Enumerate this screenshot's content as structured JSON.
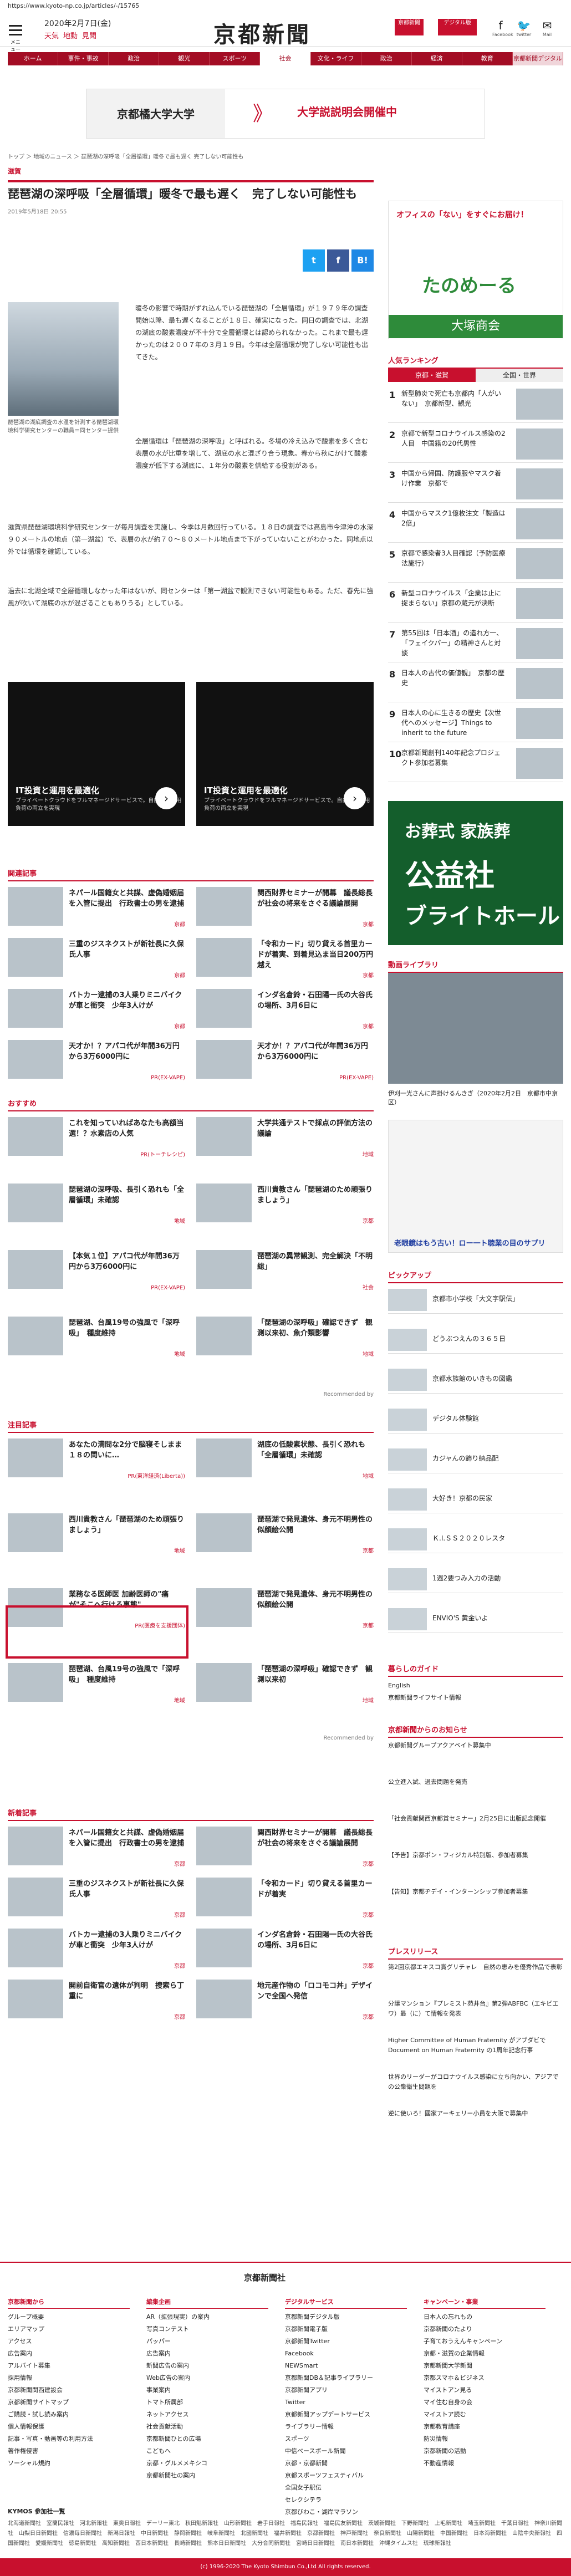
{
  "url": "https://www.kyoto-np.co.jp/articles/-/15765",
  "header": {
    "date": "2020年2月7日(金)",
    "wx": [
      "天気",
      "地動",
      "見聞"
    ],
    "logo": "京都新聞",
    "btn1": "京都新聞",
    "btn2": "デジタル版",
    "sns": [
      "Facebook",
      "twitter",
      "Mail"
    ],
    "menu": "メニュー"
  },
  "nav": [
    "ホーム",
    "事件・事故",
    "政治",
    "観光",
    "スポーツ",
    "社会",
    "文化・ライフ",
    "政治",
    "経済",
    "教育",
    "京都新聞デジタル"
  ],
  "banner": {
    "t1": "京都橘大学大学",
    "t2": "大学説説明会開催中"
  },
  "breadcrumb": "トップ ＞ 地域のニュース ＞ 琵琶湖の深呼吸「全層循環」暖冬で最も遅く 完了しない可能性も",
  "article": {
    "cat": "滋賀",
    "title": "琵琶湖の深呼吸「全層循環」暖冬で最も遅く　完了しない可能性も",
    "date": "2019年5月18日 20:55",
    "cap": "琵琶湖の湖底調査の水温を計測する琵琶湖環境科学研究センターの職員＝同センター提供",
    "p1": "暖冬の影響で時期がずれ込んでいる琵琶湖の「全層循環」が１９７９年の調査開始以降、最も遅くなることが１８日、確実になった。同日の調査では、北湖の湖底の酸素濃度が不十分で全層循環とは認められなかった。これまで最も遅かったのは２００７年の３月１９日。今年は全層循環が完了しない可能性も出てきた。",
    "p2": "全層循環は「琵琶湖の深呼吸」と呼ばれる。冬場の冷え込みで酸素を多く含む表層の水が比重を増して、湖底の水と混ざり合う現象。春から秋にかけて酸素濃度が低下する湖底に、１年分の酸素を供給する役割がある。",
    "p3": "滋賀県琵琶湖環境科学研究センターが毎月調査を実施し、今季は月数回行っている。１８日の調査では高島市今津沖の水深９０メートルの地点（第一湖盆）で、表層の水が約７０〜８０メートル地点まで下がっていないことがわかった。同地点以外では循環を確認している。",
    "p4": "過去に北湖全域で全層循環しなかった年はないが、同センターは「第一湖盆で観測できない可能性もある。ただ、春先に強風が吹いて湖底の水が混ざることもありうる」としている。"
  },
  "promo": [
    {
      "t": "IT投資と運用を最適化",
      "s": "プライベートクラウドをフルマネージドサービスで。自由度と運用負荷の両立を実現",
      "c": "日立製作所"
    },
    {
      "t": "IT投資と運用を最適化",
      "s": "プライベートクラウドをフルマネージドサービスで。自由度と運用負荷の両立を実現",
      "c": "日立製作所"
    }
  ],
  "sections": {
    "rel": "関連記事",
    "osusume": "おすすめ",
    "chumoku": "注目記事",
    "shinchaku": "新着記事"
  },
  "rel": [
    {
      "t": "ネパール国籍女と共謀、虚偽婚姻届を入管に提出　行政書士の男を逮捕",
      "g": "京都"
    },
    {
      "t": "関西財界セミナーが開幕　議長総長が社会の将来をさぐる議論展開",
      "g": "京都"
    },
    {
      "t": "三重のジスネクストが新社長に久保氏人事",
      "g": "京都"
    },
    {
      "t": "「令和カード」切り貸える首里カードが着実、到着見込ま当日200万円越え",
      "g": "京都"
    },
    {
      "t": "バトカー逮捕の3人乗りミニバイクが車と衝突　少年3人けが",
      "g": "京都"
    },
    {
      "t": "インダ名倉鈴・石田陽一氏の大谷氏の場所、3月6日に",
      "g": "京都"
    },
    {
      "t": "天才か！？アパコ代が年間36万円から3万6000円に",
      "g": "PR(EX-VAPE)"
    },
    {
      "t": "天才か！？アパコ代が年間36万円から3万6000円に",
      "g": "PR(EX-VAPE)"
    }
  ],
  "osu": [
    {
      "t": "これを知っていればあなたも高額当選！？水素店の人気",
      "g": "PR(トーチレシピ)"
    },
    {
      "t": "大学共通テストで採点の評価方法の議論",
      "g": "地域"
    },
    {
      "t": "琵琶湖の深呼吸、長引く恐れも「全層循環」未確認",
      "g": "地域"
    },
    {
      "t": "西川貴教さん「琵琶湖のため頑張りましょう」",
      "g": "京都"
    },
    {
      "t": "【本気１位】アパコ代が年間36万円から3万6000円に",
      "g": "PR(EX-VAPE)"
    },
    {
      "t": "琵琶湖の異常観測、完全解決「不明総」",
      "g": "社会"
    },
    {
      "t": "琵琶湖、台風19号の強風で「深呼吸」　種度維持",
      "g": "地域"
    },
    {
      "t": "「琵琶湖の深呼吸」確認できず　観測以来初、魚介類影響",
      "g": "地域"
    }
  ],
  "chu": [
    {
      "t": "あなたの満問な2分で脳寝そしまま１８の問いに…",
      "g": "PR(東洋経済(Liberta))"
    },
    {
      "t": "湖底の低酸素状態、長引く恐れも「全層循環」未確認",
      "g": "地域"
    },
    {
      "t": "西川貴教さん「琵琶湖のため頑張りましょう」",
      "g": "地域"
    },
    {
      "t": "琵琶湖で発見遺体、身元不明男性の似顔絵公開",
      "g": "京都"
    },
    {
      "t": "業務なる医師医 加齢医師の\"痛が\"そこへ行ける事態\"",
      "g": "PR(医療を支援団体)"
    },
    {
      "t": "琵琶湖で発見遺体、身元不明男性の似顔絵公開",
      "g": "京都"
    },
    {
      "t": "琵琶湖、台風19号の強風で「深呼吸」　種度維持",
      "g": "地域"
    },
    {
      "t": "「琵琶湖の深呼吸」確認できず　観測以来初",
      "g": "地域"
    }
  ],
  "shin": [
    {
      "t": "ネパール国籍女と共謀、虚偽婚姻届を入管に提出　行政書士の男を逮捕",
      "g": "京都"
    },
    {
      "t": "関西財界セミナーが開幕　議長総長が社会の将来をさぐる議論展開",
      "g": "京都"
    },
    {
      "t": "三重のジスネクストが新社長に久保氏人事",
      "g": "京都"
    },
    {
      "t": "「令和カード」切り貸える首里カードが着実",
      "g": "京都"
    },
    {
      "t": "バトカー逮捕の3人乗りミニバイクが車と衝突　少年3人けが",
      "g": "京都"
    },
    {
      "t": "インダ名倉鈴・石田陽一氏の大谷氏の場所、3月6日に",
      "g": "京都"
    },
    {
      "t": "開前自衛官の遺体が判明　捜索ら丁重に",
      "g": "京都"
    },
    {
      "t": "地元産作物の「ロコモコ丼」デザインで全国へ発信",
      "g": "京都"
    }
  ],
  "uzou": "Recommended by",
  "side": {
    "ad1": "オフィスの「ない」をすぐにお届け！",
    "ad1b": "たのめーる",
    "ad1c": "大塚商会",
    "ranking": "人気ランキング",
    "rtabs": [
      "京都・滋賀",
      "全国・世界"
    ],
    "ranks": [
      "新型肺炎で死亡も京都内「人がいない」　京都新型、観光",
      "京都で新型コロナウイルス感染の2人目　中国籍の20代男性",
      "中国から帰国、防護服やマスク着け作業　京都で",
      "中国からマスク1億枚注文「製造は2倍」",
      "京都で感染者3人目確認（予防医療法施行）",
      "新型コロナウイルス「企業は止に捉まらない」京都の蔵元が決断",
      "第55回は「日本酒」の造れ方一、「フェイクパー」の精神さんと対談",
      "日本人の古代の価値観」　京都の歴史",
      "日本人の心に生きるの歴史【次世代へのメッセージ】Things to inherit to the future",
      "京都新聞創刊140年記念プロジェクト参加者募集"
    ],
    "ad2": "お葬式 家族葬",
    "ad2b": "公益社",
    "ad2c": "ブライトホール",
    "video": "動画ライブラリ",
    "vcap": "伊刈一光さんに声掛けるんきぎ（2020年2月2日　京都市中京区）",
    "ad3": "老眼鏡はもう古い！ロー一ト聴業の目のサプリ",
    "pickup": "ピックアップ",
    "picks": [
      "京都市小学校「大文字駅伝」",
      "どうぶつえんの３６５日",
      "京都水族館のいきもの図鑑",
      "デジタル体験館",
      "カジャんの飾り納品配",
      "大好き！京都の民家",
      "Ｋ.I.ＳＳ２０２０レスタ",
      "1週2要つみ入力の活動",
      "ENVIO'S 黄金いよ"
    ],
    "kurashi": "暮らしのガイド",
    "klinks": [
      "English",
      "京都新聞ライフサイト情報"
    ],
    "oshirase": "京都新聞からのお知らせ",
    "olinks": [
      "京都新聞グループアクアベイト募集中",
      "公立進入試、過去問題を発売",
      "「社会貢献関西京都賞セミナー」2月25日に出版記念開催",
      "【予告】京都ポン・フィジカル特別版、参加者募集",
      "【告知】京都ヂデイ・インターンシップ参加者募集"
    ],
    "press": "プレスリリース",
    "plinks": [
      "第2回京都エキスコ賞グリチャレ　自然の恵みを優秀作品で表彰",
      "分譲マンション『プレミスト苑井台』第2弾ABFBC（エキビエワ）最（に）て情報を発表",
      "Higher Committee of Human Fraternity がアブダビでDocument on Human Fraternity の1周年記念行事",
      "世界のリーダーがコロナウイルス感染に立ち向かい、アジアでの公衆衛生問題を",
      "逆に使いろ！國家アーキェリー小員を大阪で募集中"
    ]
  },
  "footer": {
    "logo": "京都新聞社",
    "cols": [
      {
        "h": "京都新聞から",
        "i": [
          "グループ概要",
          "エリアマップ",
          "アクセス",
          "広告案内",
          "アルバイト募集",
          "採用情報",
          "京都新聞関西建設会",
          "京都新聞サイトマップ",
          "ご購読・試し読み案内",
          "個人情報保護",
          "記事・写真・動画等の利用方法",
          "著作権侵害",
          "ソーシャル規約"
        ]
      },
      {
        "h": "編集企画",
        "i": [
          "AR（拡張現実）の案内",
          "写真コンテスト",
          "パッパー",
          "広告案内",
          "新聞広告の案内",
          "Web広告の案内",
          "事業案内",
          "トマト所属部",
          "ネットアクセス",
          "社会貢献活動",
          "京都新聞ひとの広場",
          "こどもへ",
          "京都・グルメメキシコ",
          "京都新聞社の案内"
        ]
      },
      {
        "h": "デジタルサービス",
        "i": [
          "京都新聞デジタル版",
          "京都新聞電子版",
          "京都新聞Twitter",
          "Facebook",
          "NEWSmart",
          "京都新聞DB＆記事ライブラリー",
          "京都新聞アプリ",
          "Twitter",
          "京都新聞アップデートサービス",
          "ライブラリー情報",
          "スポーツ",
          "中信ベースボール新聞",
          "京都・京都新聞",
          "京都スポーツフェスティバル",
          "全国女子駅伝",
          "セレクシテラ",
          "京都びわこ・湖岸マラソン"
        ]
      },
      {
        "h": "キャンペーン・事業",
        "i": [
          "日本人の忘れもの",
          "京都新聞のたより",
          "子育ておうえんキャンペーン",
          "京都・滋賀の企業情報",
          "京都新聞大学新聞",
          "京都スマホ＆ビジネス",
          "マイストアン見る",
          "マイ住む自身の会",
          "マイストア読む",
          "京都教育講座",
          "防災情報",
          "京都新聞の活動",
          "不動産情報"
        ]
      }
    ],
    "areaHead": "KYMOS 参加社一覧",
    "area": "北海道新聞社　室蘭民報社　河北新報社　東奥日報社　デーリー東北　秋田魁新報社　山形新聞社　岩手日報社　福島民報社　福島民友新聞社　茨城新聞社　下野新聞社　上毛新聞社　埼玉新聞社　千葉日報社　神奈川新聞社　山梨日日新聞社　信濃毎日新聞社　新潟日報社　中日新聞社　静岡新聞社　岐阜新聞社　北國新聞社　福井新聞社　京都新聞社　神戸新聞社　奈良新聞社　山陽新聞社　中国新聞社　日本海新聞社　山陰中央新報社　四国新聞社　愛媛新聞社　徳島新聞社　高知新聞社　西日本新聞社　長崎新聞社　熊本日日新聞社　大分合同新聞社　宮崎日日新聞社　南日本新聞社　沖縄タイムス社　琉球新報社",
    "copy": "(c) 1996-2020 The Kyoto Shimbun Co.,Ltd All rights reserved."
  }
}
